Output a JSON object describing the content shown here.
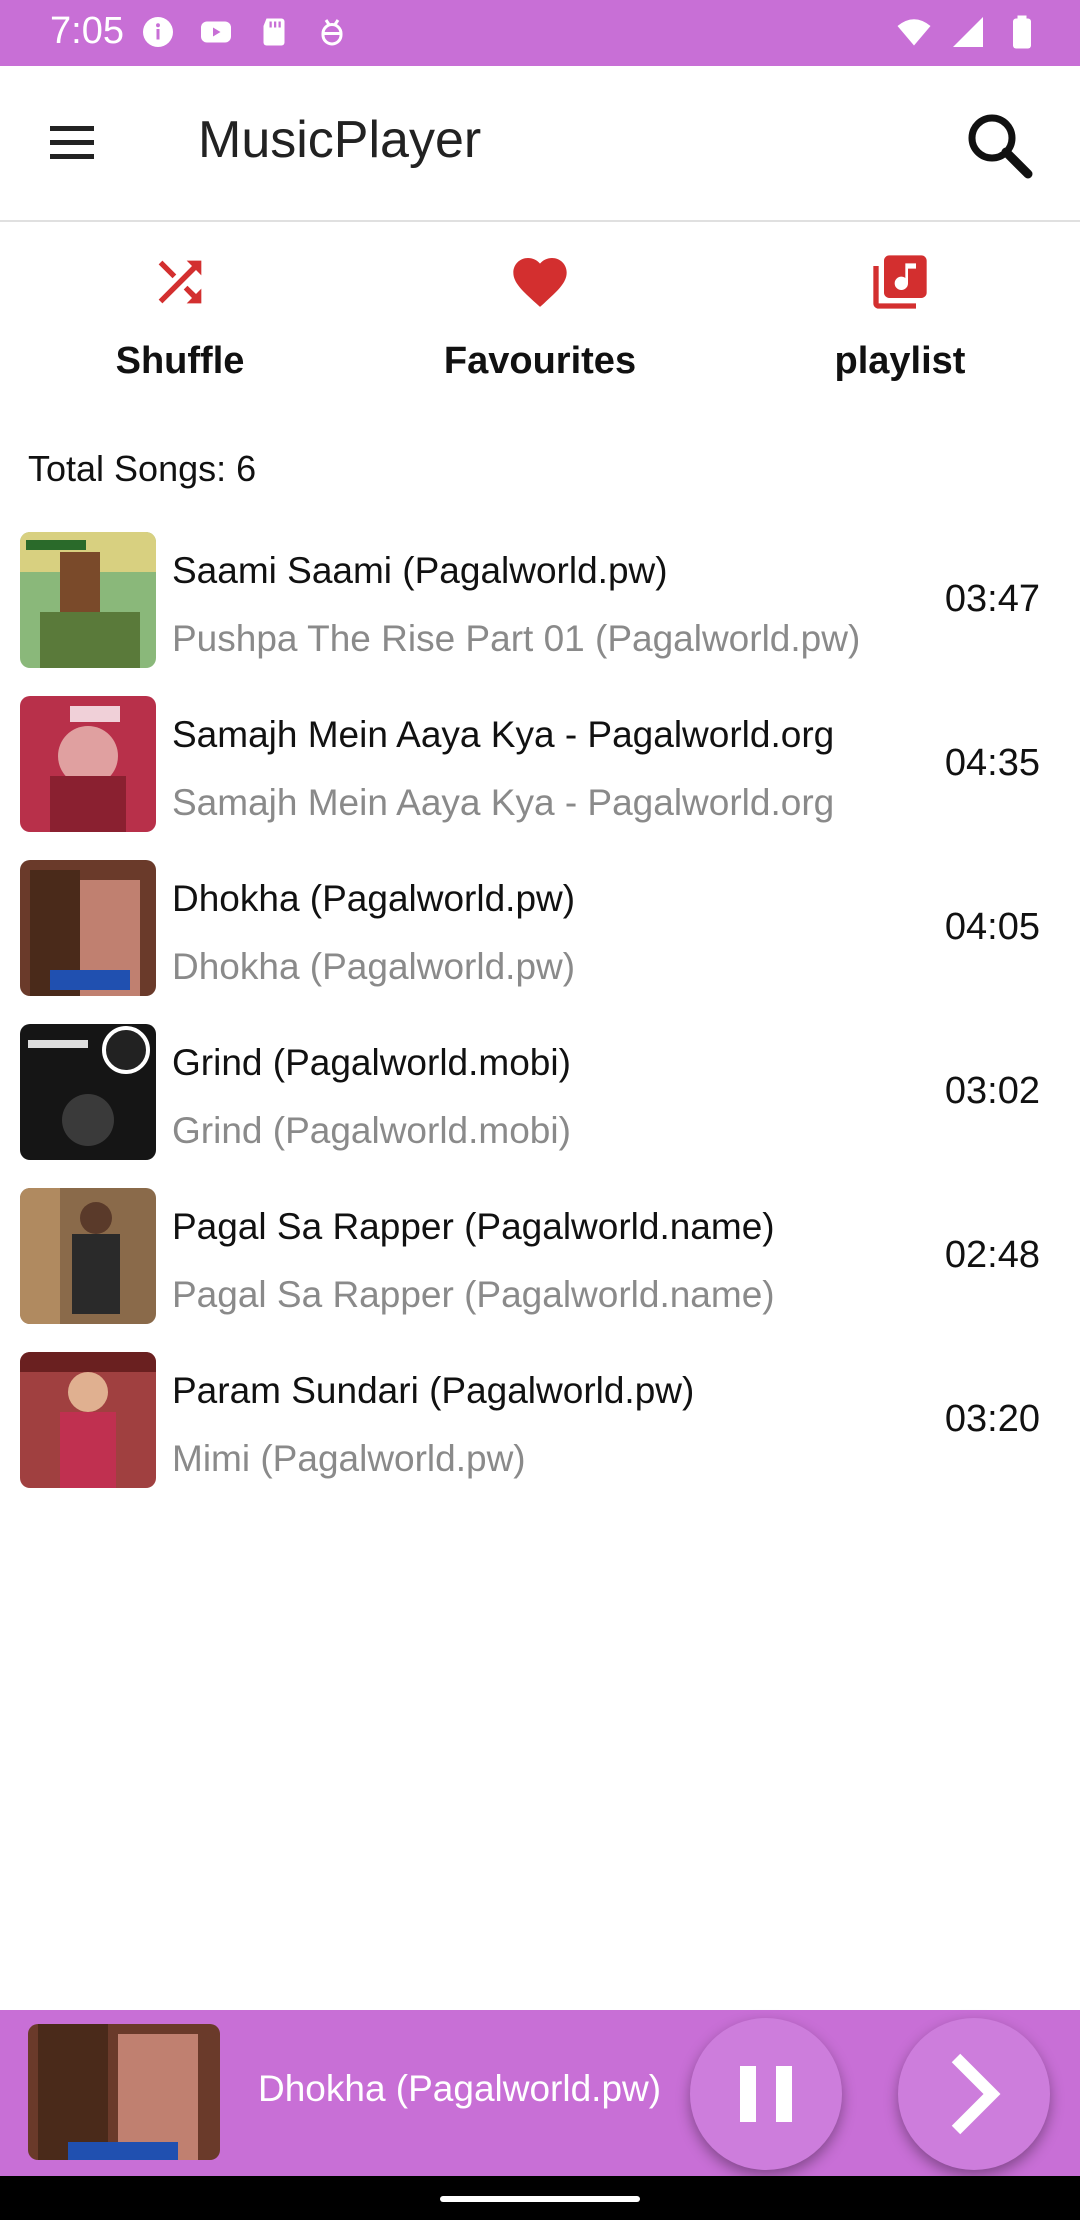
{
  "status_bar": {
    "time": "7:05",
    "bg_color": "#c86fd6",
    "left_icons": [
      "info-icon",
      "youtube-icon",
      "sd-card-icon",
      "android-debug-icon"
    ],
    "right_icons": [
      "wifi-icon",
      "signal-icon",
      "battery-icon"
    ]
  },
  "app_bar": {
    "title": "MusicPlayer",
    "menu_icon": "hamburger-menu-icon",
    "search_icon": "search-icon"
  },
  "tabs": [
    {
      "label": "Shuffle",
      "icon": "shuffle-icon",
      "color": "#d32f2f"
    },
    {
      "label": "Favourites",
      "icon": "heart-icon",
      "color": "#d32f2f"
    },
    {
      "label": "playlist",
      "icon": "playlist-music-icon",
      "color": "#d32f2f"
    }
  ],
  "total_songs": "Total Songs: 6",
  "songs": [
    {
      "title": "Saami Saami (Pagalworld.pw)",
      "album": "Pushpa The Rise Part 01 (Pagalworld.pw)",
      "duration": "03:47"
    },
    {
      "title": "Samajh Mein Aaya Kya - Pagalworld.org",
      "album": "Samajh Mein Aaya Kya - Pagalworld.org",
      "duration": "04:35"
    },
    {
      "title": "Dhokha (Pagalworld.pw)",
      "album": "Dhokha (Pagalworld.pw)",
      "duration": "04:05"
    },
    {
      "title": "Grind (Pagalworld.mobi)",
      "album": "Grind (Pagalworld.mobi)",
      "duration": "03:02"
    },
    {
      "title": "Pagal Sa Rapper (Pagalworld.name)",
      "album": "Pagal Sa Rapper (Pagalworld.name)",
      "duration": "02:48"
    },
    {
      "title": "Param Sundari (Pagalworld.pw)",
      "album": "Mimi (Pagalworld.pw)",
      "duration": "03:20"
    }
  ],
  "now_playing": {
    "title": "Dhokha (Pagalworld.pw)",
    "bg_color": "#c86fd6",
    "pause_icon": "pause-icon",
    "next_icon": "chevron-right-icon"
  }
}
